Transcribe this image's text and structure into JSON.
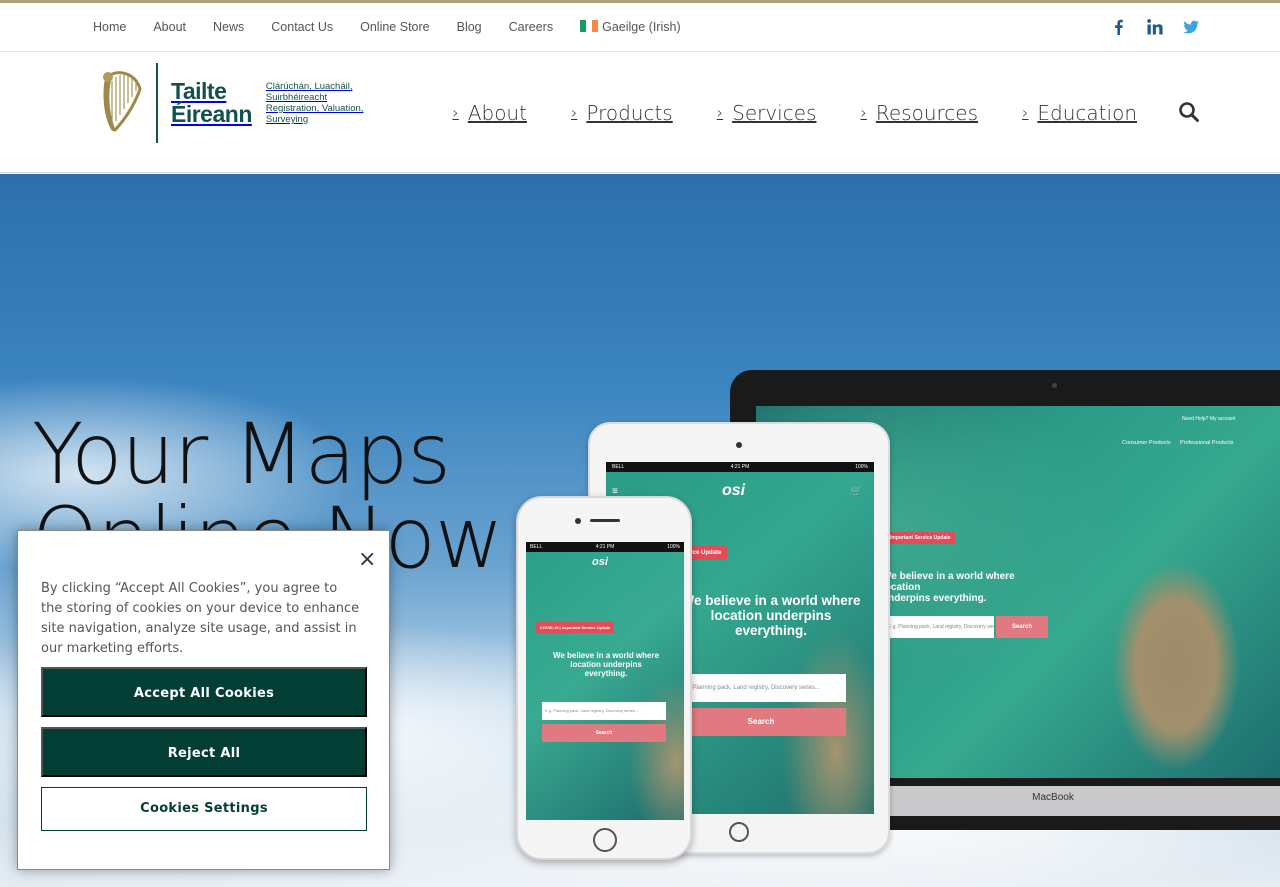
{
  "utility_nav": {
    "items": [
      "Home",
      "About",
      "News",
      "Contact Us",
      "Online Store",
      "Blog",
      "Careers"
    ],
    "language": "Gaeilge (Irish)"
  },
  "social": {
    "icons": [
      "facebook-icon",
      "linkedin-icon",
      "twitter-icon"
    ],
    "color": "#1e5a8e"
  },
  "logo": {
    "name_line1": "Tailte",
    "name_line2": "Éireann",
    "sub_line1": "Clárúchán, Luacháil,",
    "sub_line2": "Suirbhéireacht",
    "sub_line3": "Registration, Valuation,",
    "sub_line4": "Surveying",
    "brand_color": "#13514d"
  },
  "main_nav": {
    "items": [
      "About",
      "Products",
      "Services",
      "Resources",
      "Education"
    ],
    "search_icon": "search-icon"
  },
  "hero": {
    "title_line1": "Your Maps",
    "title_line2": "Online Now",
    "laptop": {
      "links": [
        "Need Help?",
        "My account",
        "Consumer Products",
        "Professional Products"
      ],
      "badge": "Important Service Update",
      "headline_line1": "We believe in a world where location",
      "headline_line2": "underpins everything.",
      "placeholder": "E.g. Planning pack, Land registry, Discovery series...",
      "search": "Search",
      "brand": "MacBook"
    },
    "tablet": {
      "status_carrier": "BELL",
      "status_time": "4:21 PM",
      "status_battery": "100%",
      "logo": "osi",
      "badge": "COVID-19 | Important Service Update",
      "headline_line1": "We believe in a world where",
      "headline_line2": "location underpins",
      "headline_line3": "everything.",
      "placeholder": "E.g. Planning pack, Land registry, Discovery series...",
      "search": "Search"
    },
    "phone": {
      "status_carrier": "BELL",
      "status_time": "4:21 PM",
      "status_battery": "100%",
      "logo": "osi",
      "badge": "COVID-19 | Important Service Update",
      "headline_line1": "We believe in a world where",
      "headline_line2": "location underpins",
      "headline_line3": "everything.",
      "placeholder": "E.g. Planning pack, Land registry, Discovery series...",
      "search": "Search"
    }
  },
  "cookie_banner": {
    "close_symbol": "×",
    "text": "By clicking “Accept All Cookies”, you agree to the storing of cookies on your device to enhance site navigation, analyze site usage, and assist in our marketing efforts.",
    "accept": "Accept All Cookies",
    "reject": "Reject All",
    "settings": "Cookies Settings",
    "button_color": "#033e35"
  },
  "colors": {
    "accent_bar": "#a8a17a",
    "badge": "#e24b57"
  }
}
